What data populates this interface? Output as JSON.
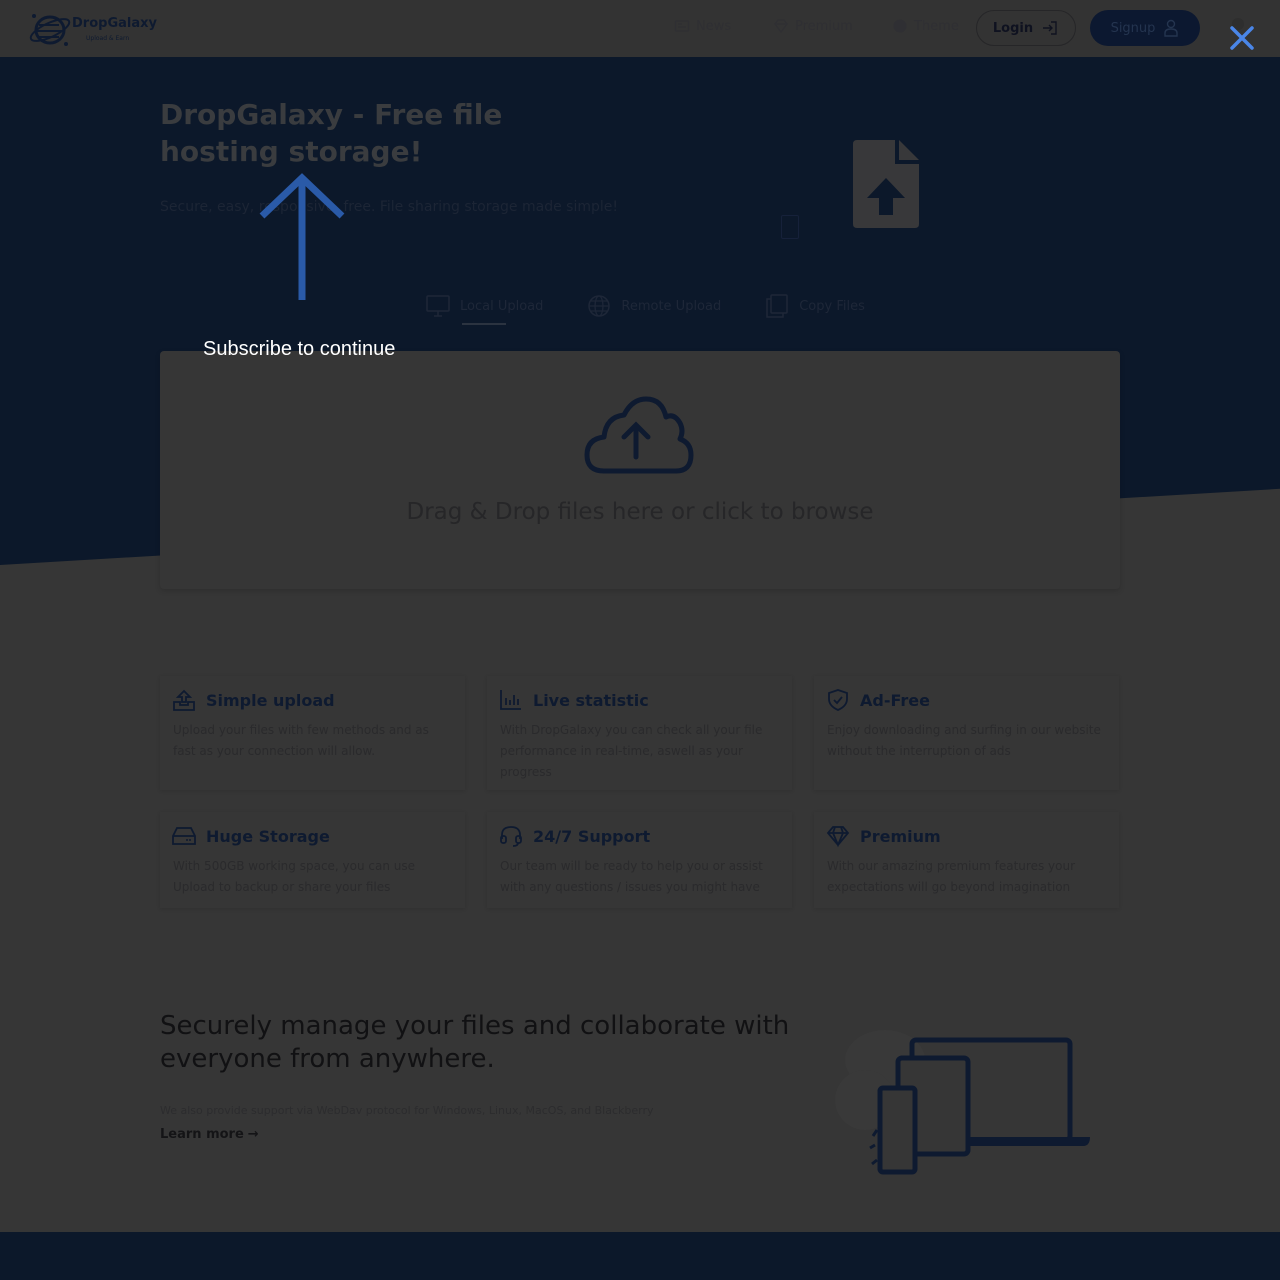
{
  "navbar": {
    "logo_name": "DropGalaxy",
    "logo_tagline": "Upload & Earn",
    "items": [
      {
        "label": "News",
        "icon": "newspaper-icon"
      },
      {
        "label": "Premium",
        "icon": "diamond-icon"
      },
      {
        "label": "Theme",
        "icon": "palette-icon"
      }
    ],
    "login_label": "Login",
    "signup_label": "Signup"
  },
  "hero": {
    "title": "DropGalaxy - Free file hosting storage!",
    "subtitle": "Secure, easy, responsive, free. File sharing storage made simple!"
  },
  "upload_tabs": [
    {
      "label": "Local Upload",
      "icon": "monitor-icon",
      "active": true
    },
    {
      "label": "Remote Upload",
      "icon": "globe-icon",
      "active": false
    },
    {
      "label": "Copy Files",
      "icon": "copy-icon",
      "active": false
    }
  ],
  "dropzone": {
    "text": "Drag & Drop files here or click to browse"
  },
  "features": [
    {
      "title": "Simple upload",
      "desc": "Upload your files with few methods and as fast as your connection will allow.",
      "icon": "upload-tray-icon"
    },
    {
      "title": "Live statistic",
      "desc": "With DropGalaxy you can check all your file performance in real-time, aswell as your progress",
      "icon": "bar-chart-icon"
    },
    {
      "title": "Ad-Free",
      "desc": "Enjoy downloading and surfing in our website without the interruption of ads",
      "icon": "shield-check-icon"
    },
    {
      "title": "Huge Storage",
      "desc": "With 500GB working space, you can use Upload to backup or share your files",
      "icon": "hard-drive-icon"
    },
    {
      "title": "24/7 Support",
      "desc": "Our team will be ready to help you or assist with any questions / issues you might have",
      "icon": "headset-icon"
    },
    {
      "title": "Premium",
      "desc": "With our amazing premium features your expectations will go beyond imagination",
      "icon": "diamond-icon"
    }
  ],
  "manage": {
    "title": "Securely manage your files and collaborate with everyone from anywhere.",
    "subtitle": "We also provide support via WebDav protocol for Windows, Linux, MacOS, and Blackberry",
    "learn_more": "Learn more",
    "learn_more_arrow": "→"
  },
  "overlay": {
    "message": "Subscribe to continue",
    "accent_color": "#2f6fd6"
  }
}
